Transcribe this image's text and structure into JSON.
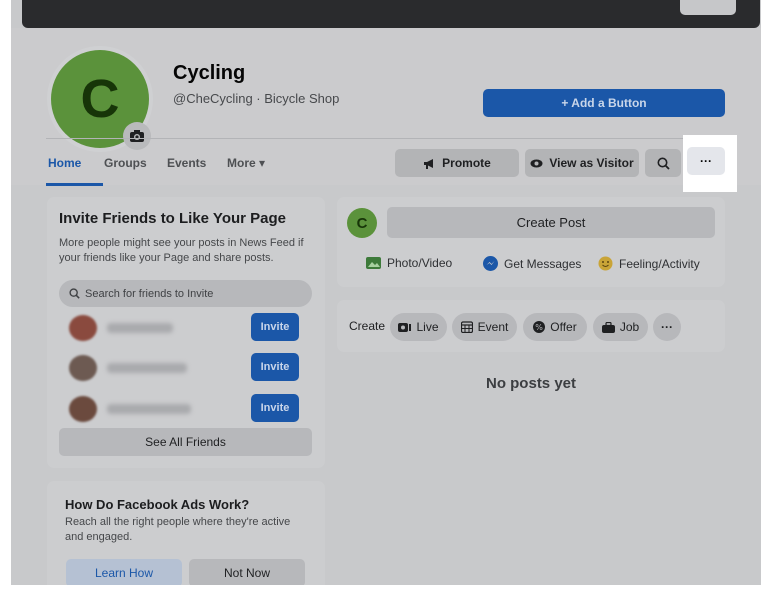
{
  "page": {
    "avatar_letter": "C",
    "name": "Cycling",
    "subtitle": "@CheCycling · Bicycle Shop",
    "add_button": "+ Add a Button"
  },
  "nav": {
    "tabs": [
      {
        "label": "Home",
        "active": true
      },
      {
        "label": "Groups"
      },
      {
        "label": "Events"
      },
      {
        "label": "More ▾"
      }
    ],
    "promote": "Promote",
    "view_as_visitor": "View as Visitor",
    "more_dots": "···"
  },
  "invite": {
    "title": "Invite Friends to Like Your Page",
    "description": "More people might see your posts in News Feed if your friends like your Page and share posts.",
    "search_placeholder": "Search for friends to Invite",
    "invite_label": "Invite",
    "see_all": "See All Friends"
  },
  "ads": {
    "title": "How Do Facebook Ads Work?",
    "description": "Reach all the right people where they're active and engaged.",
    "learn_how": "Learn How",
    "not_now": "Not Now"
  },
  "composer": {
    "avatar_letter": "C",
    "create_post": "Create Post",
    "actions": {
      "photo_video": "Photo/Video",
      "get_messages": "Get Messages",
      "feeling": "Feeling/Activity"
    }
  },
  "create_bar": {
    "label": "Create",
    "live": "Live",
    "event": "Event",
    "offer": "Offer",
    "job": "Job",
    "more": "···"
  },
  "feed": {
    "empty": "No posts yet"
  }
}
